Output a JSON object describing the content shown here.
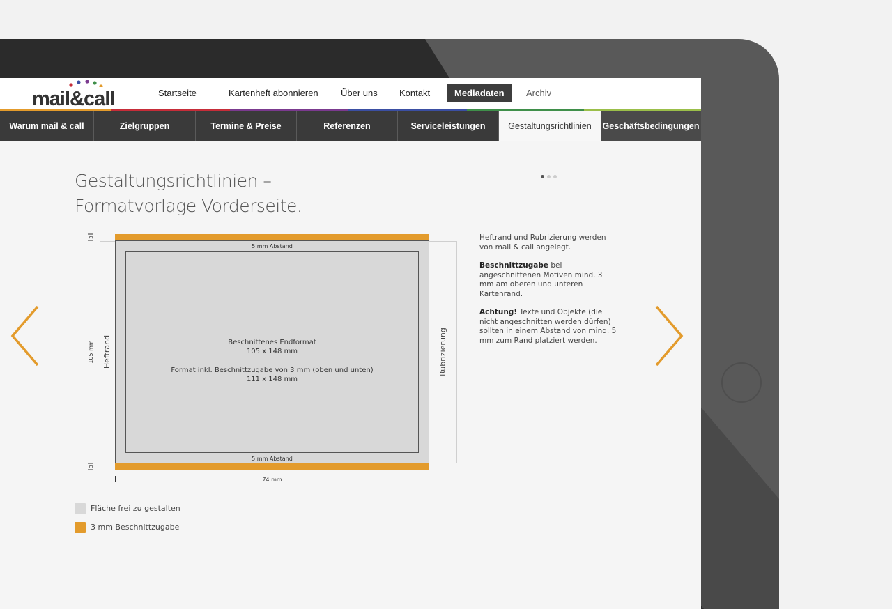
{
  "brand": {
    "logo_text": "mail&call",
    "accent": "#e39b2c",
    "dot_colors": [
      "#c62d39",
      "#3b4fa3",
      "#7b3a8f",
      "#3f8f4a",
      "#e39b2c"
    ]
  },
  "topnav": {
    "items": [
      {
        "label": "Startseite"
      },
      {
        "label": "Kartenheft abonnieren"
      },
      {
        "label": "Über uns"
      },
      {
        "label": "Kontakt"
      },
      {
        "label": "Mediadaten"
      },
      {
        "label": "Archiv"
      }
    ],
    "active": "Mediadaten",
    "bar_colors": [
      "#e39b2c",
      "#c62d39",
      "#7b3a8f",
      "#3b4fa3",
      "#2aa0b8",
      "#3f8f4a",
      "#9bbf4a"
    ]
  },
  "subnav": {
    "items": [
      {
        "label": "Warum mail & call"
      },
      {
        "label": "Zielgruppen"
      },
      {
        "label": "Termine & Preise"
      },
      {
        "label": "Referenzen"
      },
      {
        "label": "Serviceleistungen"
      },
      {
        "label": "Gestaltungsrichtlinien"
      },
      {
        "label": "Geschäftsbedingungen"
      }
    ],
    "active": "Gestaltungsrichtlinien",
    "pager": {
      "count": 3,
      "current": 1
    }
  },
  "page": {
    "title_line1": "Gestaltungsrichtlinien –",
    "title_line2": "Formatvorlage Vorderseite."
  },
  "diagram": {
    "top_margin_label": "5 mm Abstand",
    "bottom_margin_label": "5 mm Abstand",
    "bleed_mark_top": "3",
    "bleed_mark_bottom": "3",
    "height_label": "105 mm",
    "width_label": "74 mm",
    "left_label": "Heftrand",
    "right_label": "Rubrizierung",
    "center_line1": "Beschnittenes Endformat",
    "center_line2": "105 x 148 mm",
    "center_line3": "Format inkl. Beschnittzugabe von 3 mm (oben und unten)",
    "center_line4": "111 x 148 mm",
    "colors": {
      "free_area": "#d8d8d8",
      "bleed": "#e39b2c"
    }
  },
  "legend": [
    {
      "label": "Fläche frei zu gestalten",
      "color": "#d8d8d8"
    },
    {
      "label": "3 mm Beschnittzugabe",
      "color": "#e39b2c"
    }
  ],
  "sidebar": {
    "p1_text": "Heftrand und Rubrizierung werden von mail & call angelegt.",
    "p2_bold": "Beschnittzugabe",
    "p2_text": " bei angeschnittenen Motiven mind. 3 mm am oberen und unteren Kartenrand.",
    "p3_bold": "Achtung!",
    "p3_text": " Texte und Objekte (die nicht angeschnitten werden dürfen) sollten in einem Abstand von mind. 5 mm zum Rand platziert werden."
  },
  "icons": {
    "prev": "chevron-left-icon",
    "next": "chevron-right-icon"
  }
}
